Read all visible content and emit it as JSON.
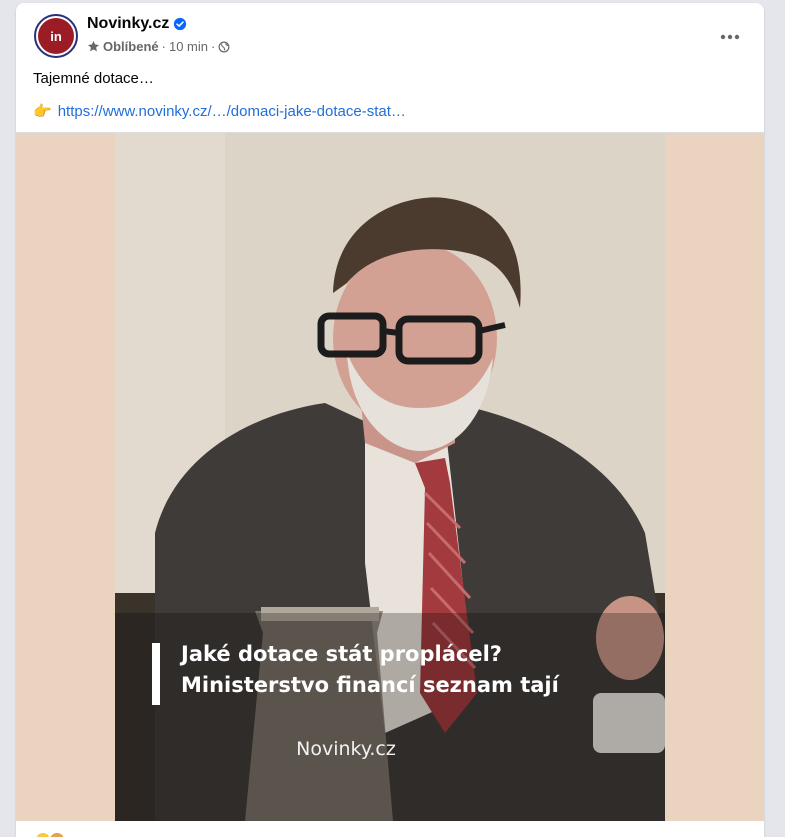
{
  "post": {
    "page_name": "Novinky.cz",
    "avatar_text": "in",
    "verified_icon": "verified-badge-icon",
    "favorite_label": "Oblíbené",
    "separator": "·",
    "time": "10 min",
    "audience_icon": "globe-icon",
    "more_icon": "more-options-icon",
    "text": "Tajemné dotace…",
    "link_emoji": "👉",
    "link_text": "https://www.novinky.cz/…/domaci-jake-dotace-stat…"
  },
  "media": {
    "headline_line1": "Jaké dotace stát proplácel?",
    "headline_line2": "Ministerstvo financí seznam tají",
    "watermark": "Novinky.cz"
  },
  "colors": {
    "link": "#216fdb",
    "avatar_bg": "#9b1c24",
    "verified": "#0866ff",
    "background": "#e4e6eb"
  }
}
